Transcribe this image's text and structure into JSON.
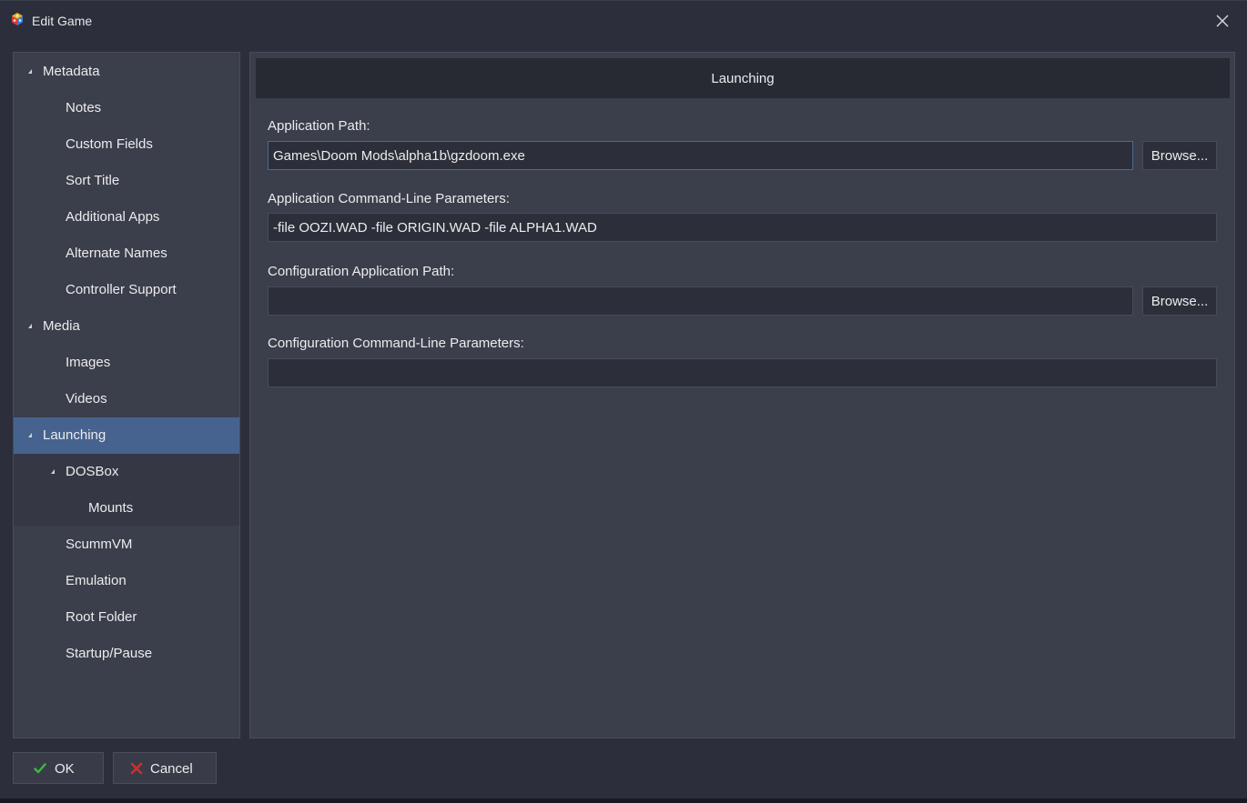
{
  "window": {
    "title": "Edit Game"
  },
  "sidebar": {
    "items": [
      {
        "label": "Metadata",
        "level": 0,
        "expanded": true
      },
      {
        "label": "Notes",
        "level": 1
      },
      {
        "label": "Custom Fields",
        "level": 1
      },
      {
        "label": "Sort Title",
        "level": 1
      },
      {
        "label": "Additional Apps",
        "level": 1
      },
      {
        "label": "Alternate Names",
        "level": 1
      },
      {
        "label": "Controller Support",
        "level": 1
      },
      {
        "label": "Media",
        "level": 0,
        "expanded": true
      },
      {
        "label": "Images",
        "level": 1
      },
      {
        "label": "Videos",
        "level": 1
      },
      {
        "label": "Launching",
        "level": 0,
        "expanded": true,
        "selected": true
      },
      {
        "label": "DOSBox",
        "level": 1,
        "expanded": true
      },
      {
        "label": "Mounts",
        "level": 2
      },
      {
        "label": "ScummVM",
        "level": 1
      },
      {
        "label": "Emulation",
        "level": 1
      },
      {
        "label": "Root Folder",
        "level": 1
      },
      {
        "label": "Startup/Pause",
        "level": 1
      }
    ]
  },
  "main": {
    "section_title": "Launching",
    "fields": {
      "app_path": {
        "label": "Application Path:",
        "value": "Games\\Doom Mods\\alpha1b\\gzdoom.exe",
        "browse_label": "Browse..."
      },
      "app_params": {
        "label": "Application Command-Line Parameters:",
        "value": "-file OOZI.WAD -file ORIGIN.WAD -file ALPHA1.WAD"
      },
      "config_path": {
        "label": "Configuration Application Path:",
        "value": "",
        "browse_label": "Browse..."
      },
      "config_params": {
        "label": "Configuration Command-Line Parameters:",
        "value": ""
      }
    }
  },
  "footer": {
    "ok_label": "OK",
    "cancel_label": "Cancel"
  },
  "colors": {
    "selected": "#46638f",
    "ok_icon": "#3dbb3d",
    "cancel_icon": "#d62b2b"
  },
  "icons": {
    "app": "cube-icon",
    "close": "close-icon",
    "ok": "checkmark-icon",
    "cancel": "cross-icon"
  }
}
